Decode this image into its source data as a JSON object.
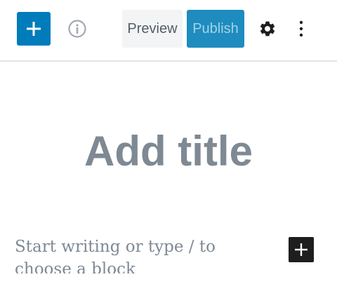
{
  "toolbar": {
    "add_block_icon": "plus-icon",
    "info_icon": "info-icon",
    "preview_label": "Preview",
    "publish_label": "Publish",
    "settings_icon": "gear-icon",
    "more_icon": "more-vertical-icon",
    "colors": {
      "accent": "#007cba",
      "publish_bg": "#1e8cbe",
      "publish_text": "#a3d3ea"
    }
  },
  "editor": {
    "title_placeholder": "Add title",
    "body_placeholder": "Start writing or type / to choose a block",
    "inserter_icon": "plus-icon",
    "placeholder_color": "#7e8993"
  }
}
